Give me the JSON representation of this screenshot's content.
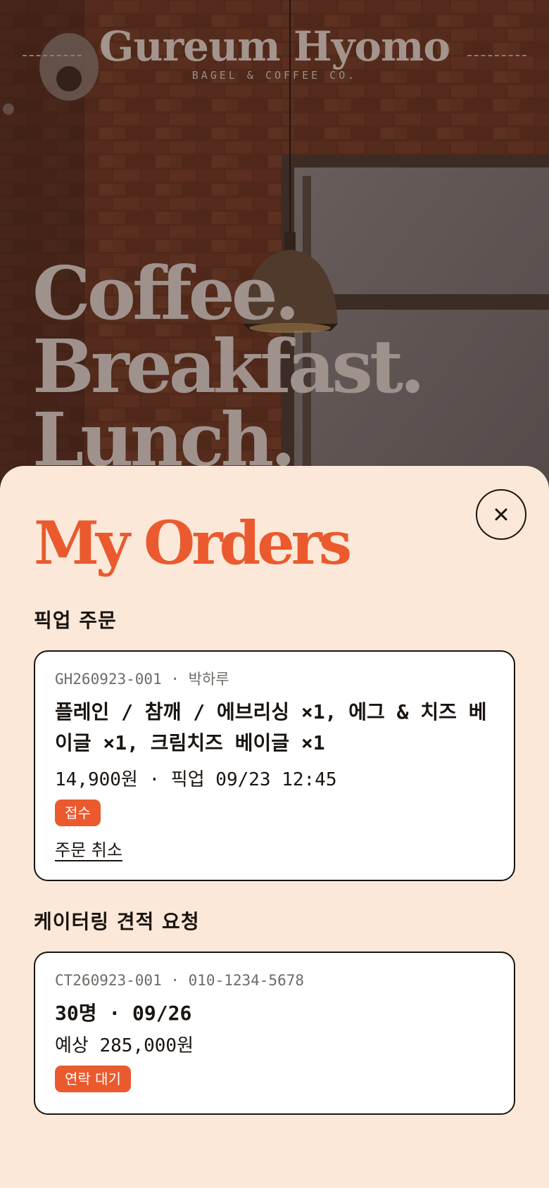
{
  "brand": {
    "title": "Gureum Hyomo",
    "subtitle": "BAGEL & COFFEE CO."
  },
  "hero": {
    "lines": [
      "Coffee.",
      "Breakfast.",
      "Lunch."
    ]
  },
  "sheet": {
    "title": "My Orders",
    "close_icon": "close-icon"
  },
  "pickup": {
    "heading": "픽업 주문",
    "order": {
      "meta": "GH260923-001 · 박하루",
      "items": "플레인 / 참깨 / 에브리싱 ×1, 에그 & 치즈 베이글 ×1, 크림치즈 베이글 ×1",
      "detail": "14,900원 · 픽업 09/23 12:45",
      "status": "접수",
      "cancel_label": "주문 취소"
    }
  },
  "catering": {
    "heading": "케이터링 견적 요청",
    "request": {
      "meta": "CT260923-001 · 010-1234-5678",
      "summary": "30명 · 09/26",
      "estimate": "예상 285,000원",
      "status": "연락 대기"
    }
  },
  "colors": {
    "accent": "#ea5a2e",
    "sheet_bg": "#fbe8d8",
    "ink": "#1a1410",
    "card_bg": "#ffffff"
  }
}
